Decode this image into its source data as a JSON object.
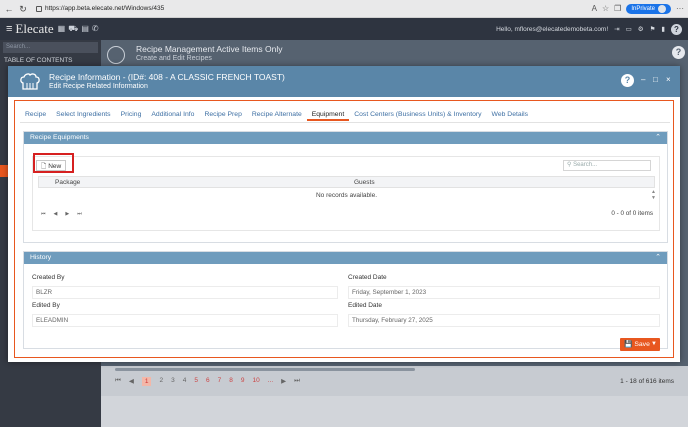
{
  "browser": {
    "url": "https://app.beta.elecate.net/Windows/435",
    "inprivate_label": "InPrivate",
    "icons": [
      "back-icon",
      "refresh-icon",
      "lock-icon",
      "read-aloud-icon",
      "favorites-icon",
      "collections-icon",
      "more-icon"
    ]
  },
  "app": {
    "brand": "Elecate",
    "user_email": "Hello, mflores@elecatedemobeta.com!",
    "help": "?"
  },
  "sidebar": {
    "search_placeholder": "Search...",
    "toc_label": "TABLE OF CONTENTS"
  },
  "background": {
    "title": "Recipe Management Active Items Only",
    "subtitle": "Create and Edit Recipes",
    "help": "?",
    "pager_pages": [
      "1",
      "2",
      "3",
      "4",
      "5",
      "6",
      "7",
      "8",
      "9",
      "10",
      "..."
    ],
    "pager_count": "1 - 18 of 616 items"
  },
  "modal": {
    "title": "Recipe Information - (ID#: 408 - A CLASSIC FRENCH TOAST)",
    "subtitle": "Edit Recipe Related Information",
    "help": "?",
    "minimize": "–",
    "maximize": "□",
    "close": "×",
    "tabs": [
      {
        "label": "Recipe"
      },
      {
        "label": "Select Ingredients"
      },
      {
        "label": "Pricing"
      },
      {
        "label": "Additional Info"
      },
      {
        "label": "Recipe Prep"
      },
      {
        "label": "Recipe Alternate"
      },
      {
        "label": "Equipment"
      },
      {
        "label": "Cost Centers (Business Units) & Inventory"
      },
      {
        "label": "Web Details"
      }
    ],
    "active_tab": "Equipment",
    "equipment": {
      "header": "Recipe Equipments",
      "new_button": "New",
      "search_placeholder": "Search...",
      "columns": [
        "Package",
        "Guests"
      ],
      "empty_message": "No records available.",
      "pager_count": "0 - 0 of 0 items"
    },
    "history": {
      "header": "History",
      "created_by_label": "Created By",
      "created_by_value": "BLZR",
      "created_date_label": "Created Date",
      "created_date_value": "Friday, September 1, 2023",
      "edited_by_label": "Edited By",
      "edited_by_value": "ELEADMIN",
      "edited_date_label": "Edited Date",
      "edited_date_value": "Thursday, February 27, 2025"
    },
    "save_button": "Save"
  },
  "colors": {
    "accent_orange": "#e8571f",
    "header_blue": "#5a86a8",
    "panel_blue": "#6f9cbd",
    "highlight_red": "#d62020"
  }
}
